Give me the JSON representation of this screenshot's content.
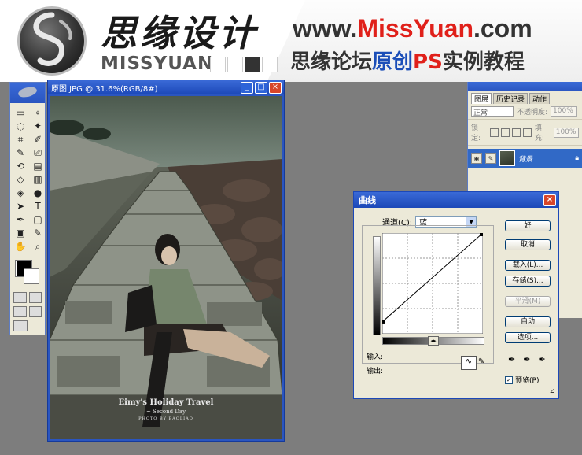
{
  "banner": {
    "brand_cn": "思缘设计",
    "brand_en": "MISSYUAN",
    "url_prefix": "www.",
    "url_miss": "Miss",
    "url_yuan": "Yuan",
    "url_suffix": ".com",
    "sub_a": "思缘论坛",
    "sub_b": "原创",
    "sub_c": "PS",
    "sub_d": "实例教程"
  },
  "document": {
    "title": "原图.JPG @ 31.6%(RGB/8#)",
    "caption_line1": "Eimy's Holiday Travel",
    "caption_line2": "~ Second Day",
    "caption_line3": "PHOTO BY BAOLIAO"
  },
  "toolbox": {
    "tools": [
      "▭",
      "⌖",
      "◌",
      "✦",
      "⌗",
      "✐",
      "✎",
      "⎚",
      "⟲",
      "▤",
      "◇",
      "▥",
      "◈",
      "●",
      "➤",
      "T",
      "✒",
      "▢",
      "▣",
      "✎",
      "✋",
      "⌕"
    ]
  },
  "layers_panel": {
    "tabs": [
      "图层",
      "历史记录",
      "动作"
    ],
    "blend_mode": "正常",
    "opacity_label": "不透明度:",
    "opacity_value": "100%",
    "lock_label": "锁定:",
    "fill_label": "填充:",
    "fill_value": "100%",
    "layer_name": "背景"
  },
  "curves_dialog": {
    "title": "曲线",
    "channel_label": "通道(C):",
    "channel_value": "蓝",
    "buttons": {
      "ok": "好",
      "cancel": "取消",
      "load": "载入(L)...",
      "save": "存储(S)...",
      "smooth": "平滑(M)",
      "auto": "自动",
      "options": "选项..."
    },
    "input_label": "输入:",
    "output_label": "输出:",
    "preview_label": "预览(P)",
    "curve_points": [
      [
        0,
        30
      ],
      [
        255,
        255
      ]
    ]
  }
}
